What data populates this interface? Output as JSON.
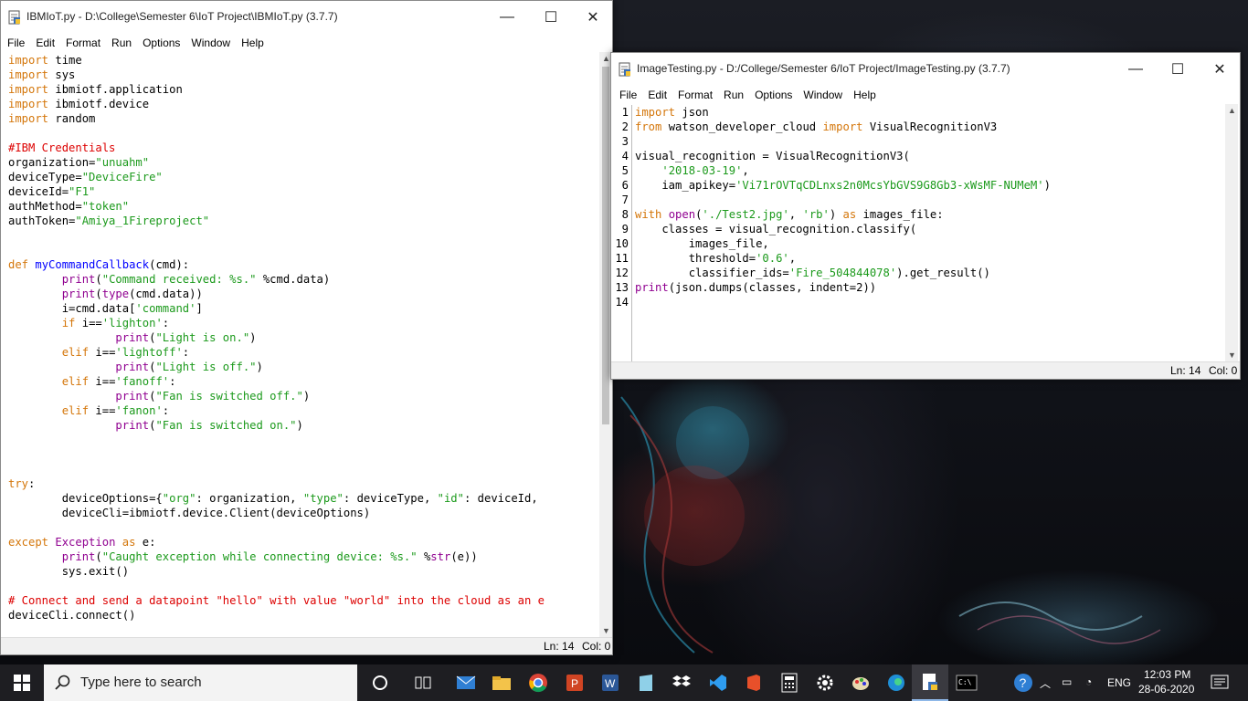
{
  "window1": {
    "title": "IBMIoT.py - D:\\College\\Semester 6\\IoT Project\\IBMIoT.py (3.7.7)",
    "menu": [
      "File",
      "Edit",
      "Format",
      "Run",
      "Options",
      "Window",
      "Help"
    ],
    "status_ln": "Ln: 14",
    "status_col": "Col: 0",
    "code": [
      [
        [
          "kw",
          "import"
        ],
        [
          "n",
          " time"
        ]
      ],
      [
        [
          "kw",
          "import"
        ],
        [
          "n",
          " sys"
        ]
      ],
      [
        [
          "kw",
          "import"
        ],
        [
          "n",
          " ibmiotf.application"
        ]
      ],
      [
        [
          "kw",
          "import"
        ],
        [
          "n",
          " ibmiotf.device"
        ]
      ],
      [
        [
          "kw",
          "import"
        ],
        [
          "n",
          " random"
        ]
      ],
      [],
      [
        [
          "com",
          "#IBM Credentials"
        ]
      ],
      [
        [
          "n",
          "organization="
        ],
        [
          "str",
          "\"unuahm\""
        ]
      ],
      [
        [
          "n",
          "deviceType="
        ],
        [
          "str",
          "\"DeviceFire\""
        ]
      ],
      [
        [
          "n",
          "deviceId="
        ],
        [
          "str",
          "\"F1\""
        ]
      ],
      [
        [
          "n",
          "authMethod="
        ],
        [
          "str",
          "\"token\""
        ]
      ],
      [
        [
          "n",
          "authToken="
        ],
        [
          "str",
          "\"Amiya_1Fireproject\""
        ]
      ],
      [],
      [],
      [
        [
          "kw",
          "def"
        ],
        [
          "n",
          " "
        ],
        [
          "def",
          "myCommandCallback"
        ],
        [
          "n",
          "(cmd):"
        ]
      ],
      [
        [
          "n",
          "        "
        ],
        [
          "bi",
          "print"
        ],
        [
          "n",
          "("
        ],
        [
          "str",
          "\"Command received: %s.\""
        ],
        [
          "n",
          " %cmd.data)"
        ]
      ],
      [
        [
          "n",
          "        "
        ],
        [
          "bi",
          "print"
        ],
        [
          "n",
          "("
        ],
        [
          "bi",
          "type"
        ],
        [
          "n",
          "(cmd.data))"
        ]
      ],
      [
        [
          "n",
          "        i=cmd.data["
        ],
        [
          "str",
          "'command'"
        ],
        [
          "n",
          "]"
        ]
      ],
      [
        [
          "n",
          "        "
        ],
        [
          "kw",
          "if"
        ],
        [
          "n",
          " i=="
        ],
        [
          "str",
          "'lighton'"
        ],
        [
          "n",
          ":"
        ]
      ],
      [
        [
          "n",
          "                "
        ],
        [
          "bi",
          "print"
        ],
        [
          "n",
          "("
        ],
        [
          "str",
          "\"Light is on.\""
        ],
        [
          "n",
          ")"
        ]
      ],
      [
        [
          "n",
          "        "
        ],
        [
          "kw",
          "elif"
        ],
        [
          "n",
          " i=="
        ],
        [
          "str",
          "'lightoff'"
        ],
        [
          "n",
          ":"
        ]
      ],
      [
        [
          "n",
          "                "
        ],
        [
          "bi",
          "print"
        ],
        [
          "n",
          "("
        ],
        [
          "str",
          "\"Light is off.\""
        ],
        [
          "n",
          ")"
        ]
      ],
      [
        [
          "n",
          "        "
        ],
        [
          "kw",
          "elif"
        ],
        [
          "n",
          " i=="
        ],
        [
          "str",
          "'fanoff'"
        ],
        [
          "n",
          ":"
        ]
      ],
      [
        [
          "n",
          "                "
        ],
        [
          "bi",
          "print"
        ],
        [
          "n",
          "("
        ],
        [
          "str",
          "\"Fan is switched off.\""
        ],
        [
          "n",
          ")"
        ]
      ],
      [
        [
          "n",
          "        "
        ],
        [
          "kw",
          "elif"
        ],
        [
          "n",
          " i=="
        ],
        [
          "str",
          "'fanon'"
        ],
        [
          "n",
          ":"
        ]
      ],
      [
        [
          "n",
          "                "
        ],
        [
          "bi",
          "print"
        ],
        [
          "n",
          "("
        ],
        [
          "str",
          "\"Fan is switched on.\""
        ],
        [
          "n",
          ")"
        ]
      ],
      [],
      [],
      [],
      [
        [
          "kw",
          "try"
        ],
        [
          "n",
          ":"
        ]
      ],
      [
        [
          "n",
          "        deviceOptions={"
        ],
        [
          "str",
          "\"org\""
        ],
        [
          "n",
          ": organization, "
        ],
        [
          "str",
          "\"type\""
        ],
        [
          "n",
          ": deviceType, "
        ],
        [
          "str",
          "\"id\""
        ],
        [
          "n",
          ": deviceId,"
        ]
      ],
      [
        [
          "n",
          "        deviceCli=ibmiotf.device.Client(deviceOptions)"
        ]
      ],
      [],
      [
        [
          "kw",
          "except"
        ],
        [
          "n",
          " "
        ],
        [
          "bi",
          "Exception"
        ],
        [
          "n",
          " "
        ],
        [
          "kw",
          "as"
        ],
        [
          "n",
          " e:"
        ]
      ],
      [
        [
          "n",
          "        "
        ],
        [
          "bi",
          "print"
        ],
        [
          "n",
          "("
        ],
        [
          "str",
          "\"Caught exception while connecting device: %s.\""
        ],
        [
          "n",
          " %"
        ],
        [
          "bi",
          "str"
        ],
        [
          "n",
          "(e))"
        ]
      ],
      [
        [
          "n",
          "        sys.exit()"
        ]
      ],
      [],
      [
        [
          "com",
          "# Connect and send a datapoint \"hello\" with value \"world\" into the cloud as an e"
        ]
      ],
      [
        [
          "n",
          "deviceCli.connect()"
        ]
      ]
    ]
  },
  "window2": {
    "title": "ImageTesting.py - D:/College/Semester 6/IoT Project/ImageTesting.py (3.7.7)",
    "menu": [
      "File",
      "Edit",
      "Format",
      "Run",
      "Options",
      "Window",
      "Help"
    ],
    "status_ln": "Ln: 14",
    "status_col": "Col: 0",
    "line_numbers": [
      "1",
      "2",
      "3",
      "4",
      "5",
      "6",
      "7",
      "8",
      "9",
      "10",
      "11",
      "12",
      "13",
      "14"
    ],
    "code": [
      [
        [
          "kw",
          "import"
        ],
        [
          "n",
          " json"
        ]
      ],
      [
        [
          "kw",
          "from"
        ],
        [
          "n",
          " watson_developer_cloud "
        ],
        [
          "kw",
          "import"
        ],
        [
          "n",
          " VisualRecognitionV3"
        ]
      ],
      [],
      [
        [
          "n",
          "visual_recognition = VisualRecognitionV3("
        ]
      ],
      [
        [
          "n",
          "    "
        ],
        [
          "str",
          "'2018-03-19'"
        ],
        [
          "n",
          ","
        ]
      ],
      [
        [
          "n",
          "    iam_apikey="
        ],
        [
          "str",
          "'Vi71rOVTqCDLnxs2n0McsYbGVS9G8Gb3-xWsMF-NUMeM'"
        ],
        [
          "n",
          ")"
        ]
      ],
      [],
      [
        [
          "kw",
          "with"
        ],
        [
          "n",
          " "
        ],
        [
          "bi",
          "open"
        ],
        [
          "n",
          "("
        ],
        [
          "str",
          "'./Test2.jpg'"
        ],
        [
          "n",
          ", "
        ],
        [
          "str",
          "'rb'"
        ],
        [
          "n",
          ") "
        ],
        [
          "kw",
          "as"
        ],
        [
          "n",
          " images_file:"
        ]
      ],
      [
        [
          "n",
          "    classes = visual_recognition.classify("
        ]
      ],
      [
        [
          "n",
          "        images_file,"
        ]
      ],
      [
        [
          "n",
          "        threshold="
        ],
        [
          "str",
          "'0.6'"
        ],
        [
          "n",
          ","
        ]
      ],
      [
        [
          "n",
          "        classifier_ids="
        ],
        [
          "str",
          "'Fire_504844078'"
        ],
        [
          "n",
          ").get_result()"
        ]
      ],
      [
        [
          "bi",
          "print"
        ],
        [
          "n",
          "(json.dumps(classes, indent=2))"
        ]
      ],
      []
    ]
  },
  "taskbar": {
    "search_placeholder": "Type here to search",
    "language": "ENG",
    "time": "12:03 PM",
    "date": "28-06-2020",
    "apps": [
      "task-view-icon",
      "mail-icon",
      "file-explorer-icon",
      "chrome-icon",
      "powerpoint-icon",
      "word-icon",
      "notepad-icon",
      "dropbox-icon",
      "vscode-icon",
      "office-icon",
      "calculator-icon",
      "settings-icon",
      "paint-icon",
      "edge-icon",
      "python-idle-icon",
      "terminal-icon"
    ]
  }
}
